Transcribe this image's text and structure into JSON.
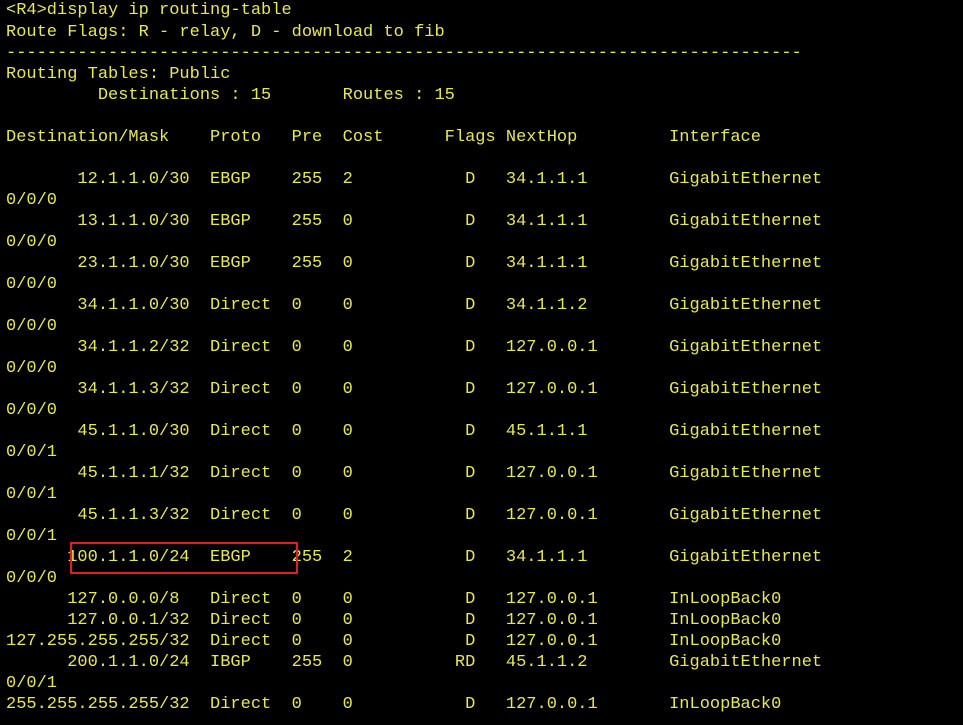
{
  "terminal": {
    "lines": [
      "<R4>display ip routing-table",
      "Route Flags: R - relay, D - download to fib",
      "------------------------------------------------------------------------------",
      "Routing Tables: Public",
      "         Destinations : 15       Routes : 15",
      "",
      "Destination/Mask    Proto   Pre  Cost      Flags NextHop         Interface",
      "",
      "       12.1.1.0/30  EBGP    255  2           D   34.1.1.1        GigabitEthernet",
      "0/0/0",
      "       13.1.1.0/30  EBGP    255  0           D   34.1.1.1        GigabitEthernet",
      "0/0/0",
      "       23.1.1.0/30  EBGP    255  0           D   34.1.1.1        GigabitEthernet",
      "0/0/0",
      "       34.1.1.0/30  Direct  0    0           D   34.1.1.2        GigabitEthernet",
      "0/0/0",
      "       34.1.1.2/32  Direct  0    0           D   127.0.0.1       GigabitEthernet",
      "0/0/0",
      "       34.1.1.3/32  Direct  0    0           D   127.0.0.1       GigabitEthernet",
      "0/0/0",
      "       45.1.1.0/30  Direct  0    0           D   45.1.1.1        GigabitEthernet",
      "0/0/1",
      "       45.1.1.1/32  Direct  0    0           D   127.0.0.1       GigabitEthernet",
      "0/0/1",
      "       45.1.1.3/32  Direct  0    0           D   127.0.0.1       GigabitEthernet",
      "0/0/1",
      "      100.1.1.0/24  EBGP    255  2           D   34.1.1.1        GigabitEthernet",
      "0/0/0",
      "      127.0.0.0/8   Direct  0    0           D   127.0.0.1       InLoopBack0",
      "      127.0.0.1/32  Direct  0    0           D   127.0.0.1       InLoopBack0",
      "127.255.255.255/32  Direct  0    0           D   127.0.0.1       InLoopBack0",
      "      200.1.1.0/24  IBGP    255  0          RD   45.1.1.2        GigabitEthernet",
      "0/0/1",
      "255.255.255.255/32  Direct  0    0           D   127.0.0.1       InLoopBack0"
    ]
  },
  "colors": {
    "background": "#000000",
    "text": "#e6e65a",
    "highlight": "#e02020"
  }
}
